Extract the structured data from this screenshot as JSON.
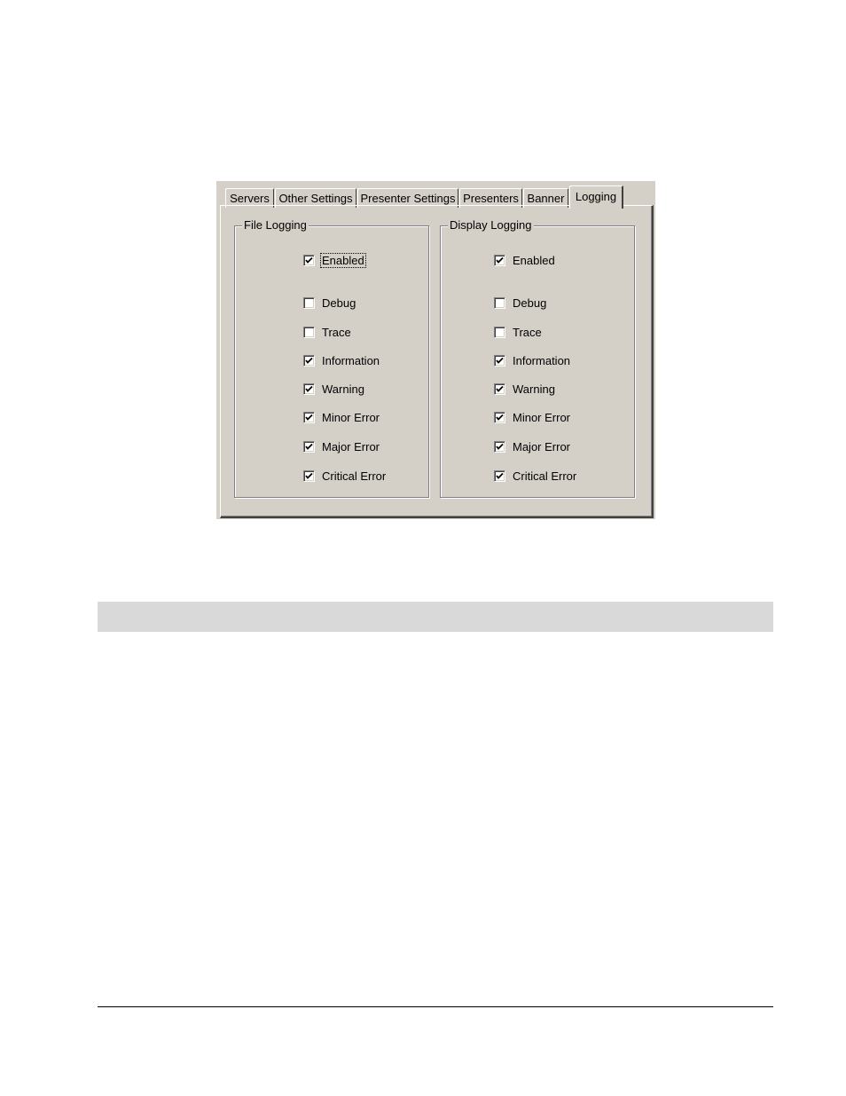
{
  "tabs": [
    {
      "label": "Servers",
      "active": false
    },
    {
      "label": "Other Settings",
      "active": false
    },
    {
      "label": "Presenter Settings",
      "active": false
    },
    {
      "label": "Presenters",
      "active": false
    },
    {
      "label": "Banner",
      "active": false
    },
    {
      "label": "Logging",
      "active": true
    }
  ],
  "groups": [
    {
      "title": "File Logging",
      "items": [
        {
          "label": "Enabled",
          "checked": true,
          "focused": true
        },
        {
          "label": "Debug",
          "checked": false
        },
        {
          "label": "Trace",
          "checked": false
        },
        {
          "label": "Information",
          "checked": true
        },
        {
          "label": "Warning",
          "checked": true
        },
        {
          "label": "Minor Error",
          "checked": true
        },
        {
          "label": "Major Error",
          "checked": true
        },
        {
          "label": "Critical Error",
          "checked": true
        }
      ]
    },
    {
      "title": "Display Logging",
      "items": [
        {
          "label": "Enabled",
          "checked": true
        },
        {
          "label": "Debug",
          "checked": false
        },
        {
          "label": "Trace",
          "checked": false
        },
        {
          "label": "Information",
          "checked": true
        },
        {
          "label": "Warning",
          "checked": true
        },
        {
          "label": "Minor Error",
          "checked": true
        },
        {
          "label": "Major Error",
          "checked": true
        },
        {
          "label": "Critical Error",
          "checked": true
        }
      ]
    }
  ]
}
